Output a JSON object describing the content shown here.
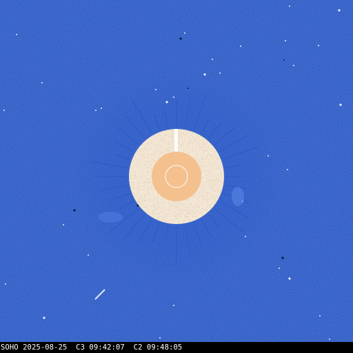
{
  "image": {
    "caption": "SOHO 2025-08-25  C3 09:42:07  C2 09:48:05"
  },
  "colors": {
    "sky_blue": "#1f4fbf",
    "sky_blue_dark": "#1a43a8",
    "occulter_disk": "#f3c08e",
    "inner_ring_noise_light": "#f6ead8",
    "inner_ring_noise_dark": "#4a2a16",
    "caption_bar": "#000000",
    "caption_text": "#ffffff"
  }
}
